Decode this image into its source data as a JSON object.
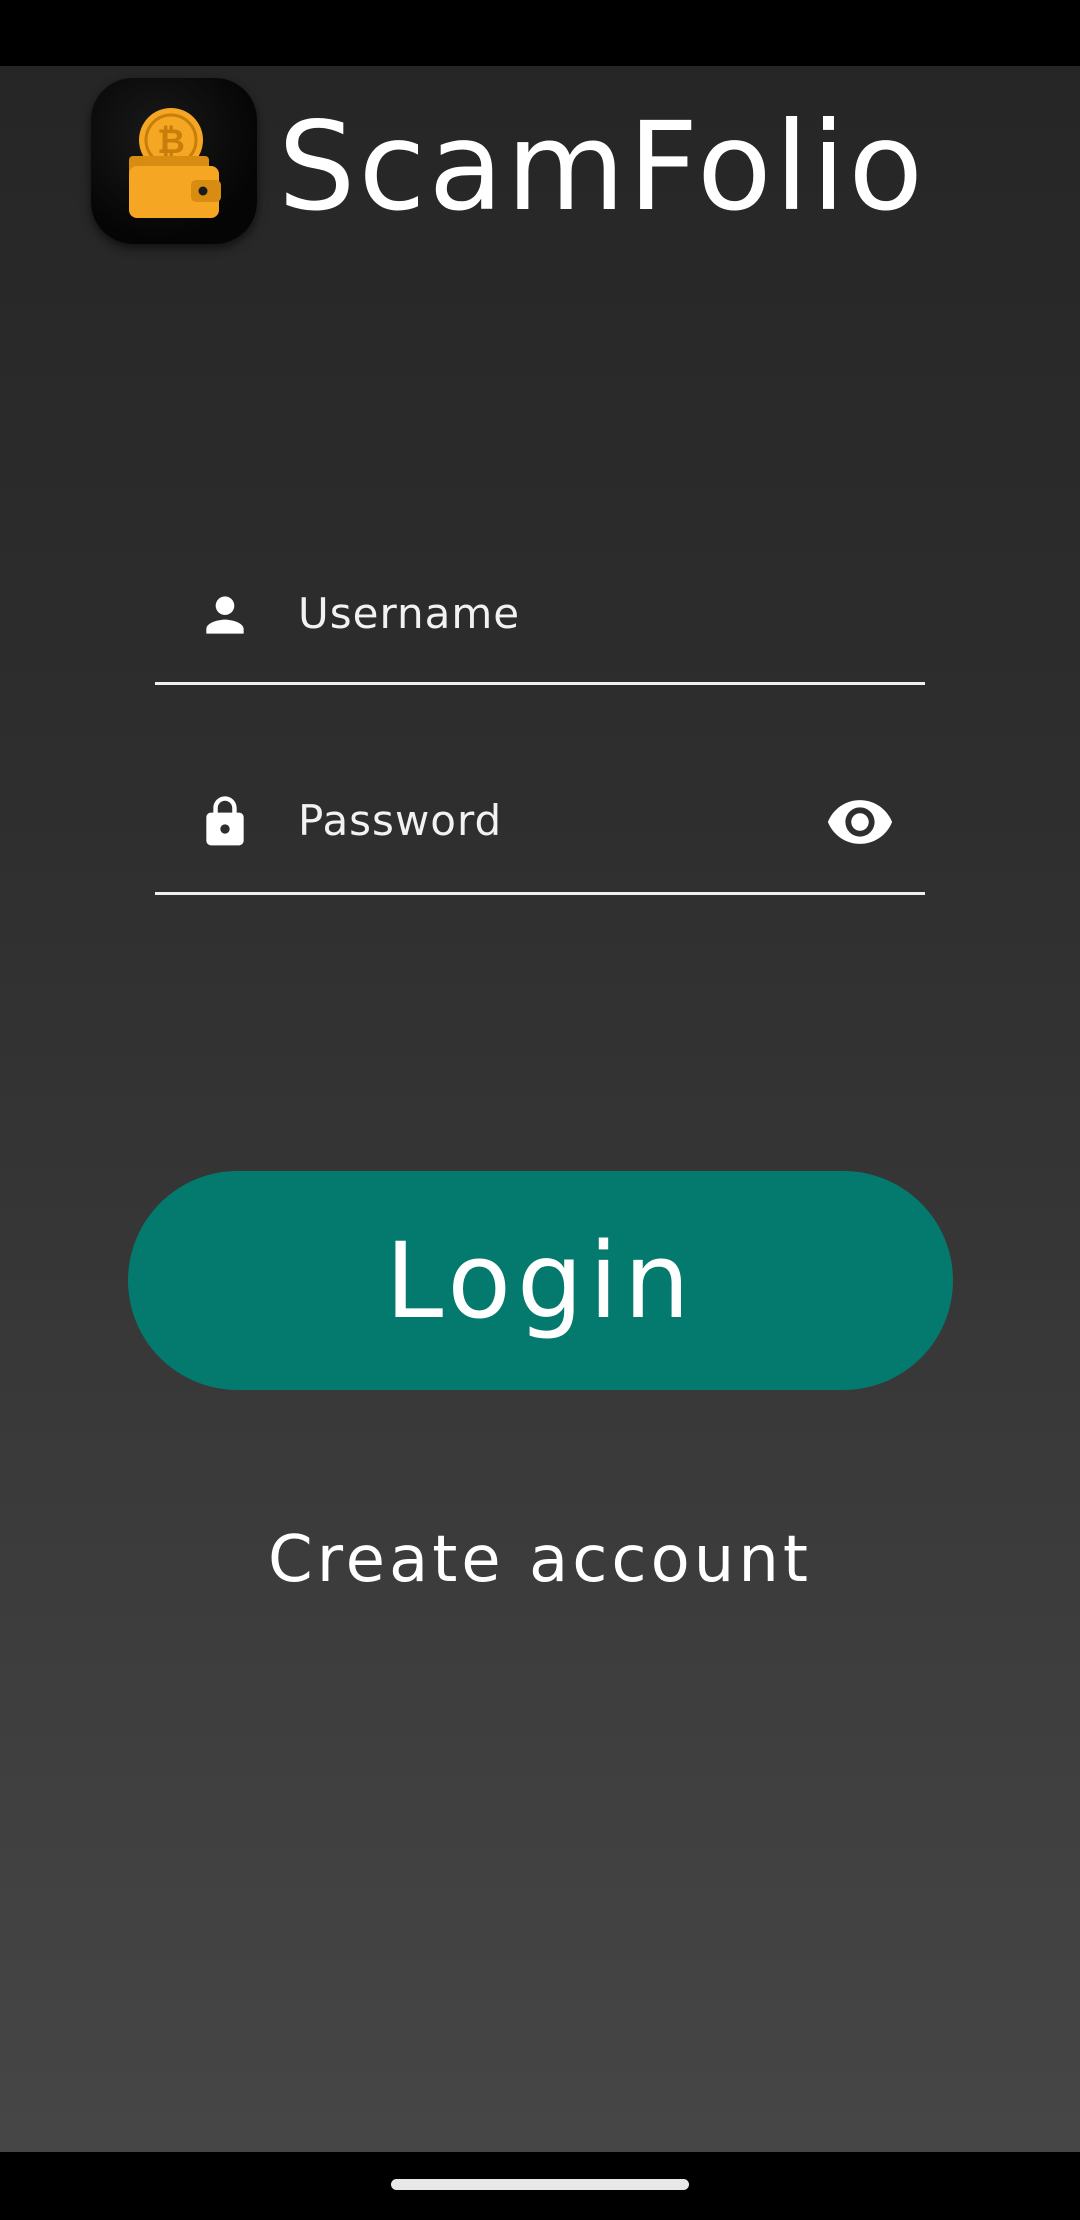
{
  "app": {
    "title": "ScamFolio",
    "logo_icon": "bitcoin-wallet-icon"
  },
  "form": {
    "username": {
      "placeholder": "Username",
      "value": "",
      "icon": "person-icon"
    },
    "password": {
      "placeholder": "Password",
      "value": "",
      "icon": "lock-icon",
      "toggle_icon": "eye-icon"
    },
    "login_label": "Login",
    "create_account_label": "Create account"
  },
  "colors": {
    "accent": "#037a6d",
    "logo_gold": "#f5a623",
    "text": "#ffffff"
  }
}
